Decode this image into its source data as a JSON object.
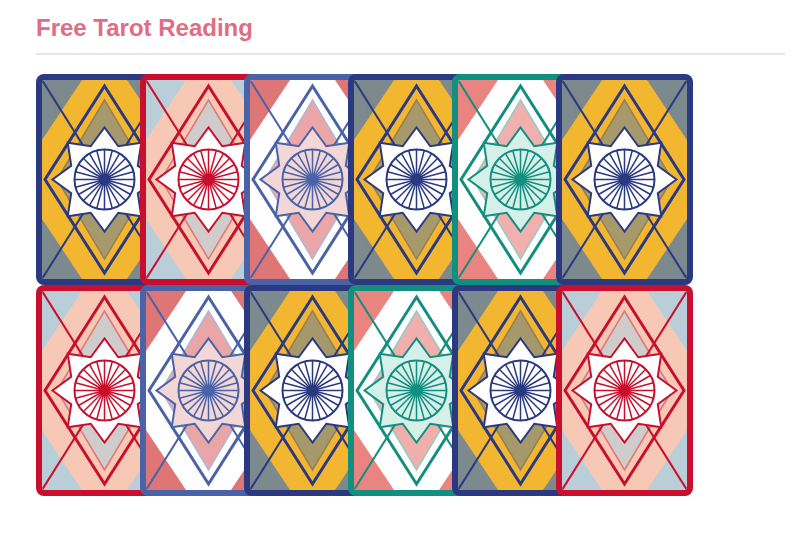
{
  "page": {
    "title": "Free Tarot Reading"
  },
  "rows": [
    {
      "cards": [
        {
          "color": "#2b3a80"
        },
        {
          "color": "#c8102e"
        },
        {
          "color": "#4a63a8"
        },
        {
          "color": "#2b3a80"
        },
        {
          "color": "#138f7f"
        },
        {
          "color": "#2b3a80"
        }
      ]
    },
    {
      "cards": [
        {
          "color": "#c8102e"
        },
        {
          "color": "#4a63a8"
        },
        {
          "color": "#2b3a80"
        },
        {
          "color": "#138f7f"
        },
        {
          "color": "#2b3a80"
        },
        {
          "color": "#c8102e"
        }
      ]
    }
  ]
}
